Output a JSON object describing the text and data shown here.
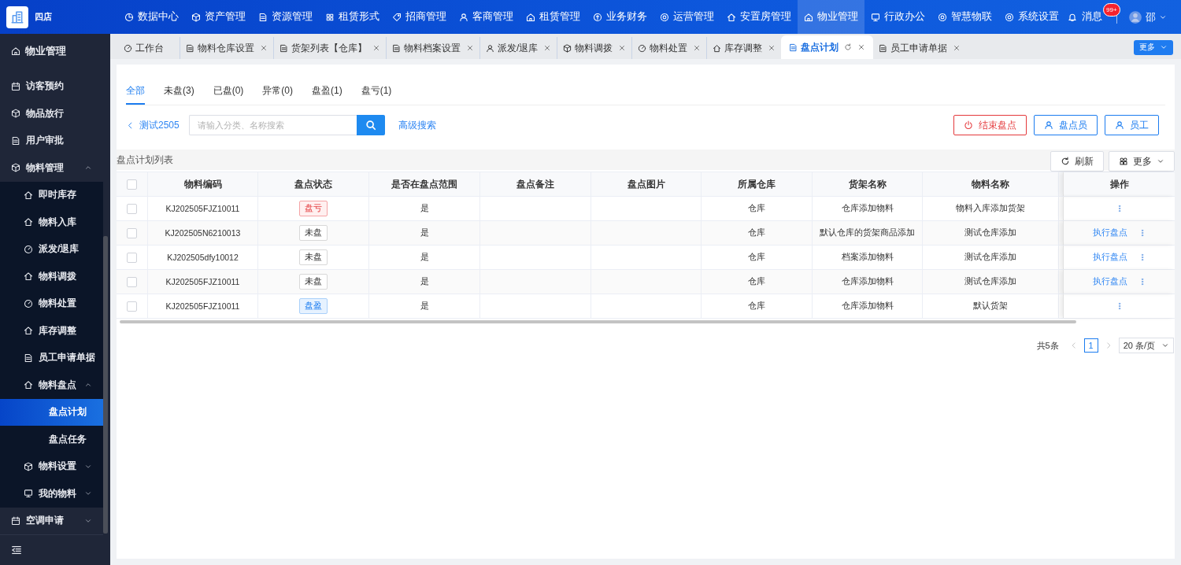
{
  "brand": {
    "name": "四店"
  },
  "top_nav": [
    {
      "label": "数据中心",
      "selected": false
    },
    {
      "label": "资产管理",
      "selected": false
    },
    {
      "label": "资源管理",
      "selected": false
    },
    {
      "label": "租赁形式",
      "selected": false
    },
    {
      "label": "招商管理",
      "selected": false
    },
    {
      "label": "客商管理",
      "selected": false
    },
    {
      "label": "租赁管理",
      "selected": false
    },
    {
      "label": "业务财务",
      "selected": false
    },
    {
      "label": "运营管理",
      "selected": false
    },
    {
      "label": "安置房管理",
      "selected": false
    },
    {
      "label": "物业管理",
      "selected": true
    },
    {
      "label": "行政办公",
      "selected": false
    },
    {
      "label": "智慧物联",
      "selected": false
    },
    {
      "label": "系统设置",
      "selected": false
    }
  ],
  "header_right": {
    "messages_label": "消息",
    "badge": "99+",
    "user": "邵"
  },
  "sidebar": {
    "title": "物业管理",
    "items": [
      {
        "label": "访客预约",
        "selected": false
      },
      {
        "label": "物品放行",
        "selected": false
      },
      {
        "label": "用户审批",
        "selected": false
      },
      {
        "label": "物料管理",
        "selected": false,
        "expanded": true,
        "children": [
          {
            "label": "即时库存",
            "selected": false
          },
          {
            "label": "物料入库",
            "selected": false
          },
          {
            "label": "派发/退库",
            "selected": false
          },
          {
            "label": "物料调拨",
            "selected": false
          },
          {
            "label": "物料处置",
            "selected": false
          },
          {
            "label": "库存调整",
            "selected": false
          },
          {
            "label": "员工申请单据",
            "selected": false
          },
          {
            "label": "物料盘点",
            "selected": false,
            "expanded": true,
            "children": [
              {
                "label": "盘点计划",
                "selected": true
              },
              {
                "label": "盘点任务",
                "selected": false
              }
            ]
          },
          {
            "label": "物料设置",
            "selected": false,
            "expanded": false
          },
          {
            "label": "我的物料",
            "selected": false,
            "expanded": false
          }
        ]
      },
      {
        "label": "空调申请",
        "selected": false,
        "expanded": false
      }
    ]
  },
  "page_tabs": [
    {
      "label": "工作台",
      "selected": false,
      "closable": false
    },
    {
      "label": "物料仓库设置",
      "selected": false,
      "closable": true
    },
    {
      "label": "货架列表【仓库】",
      "selected": false,
      "closable": true
    },
    {
      "label": "物料档案设置",
      "selected": false,
      "closable": true
    },
    {
      "label": "派发/退库",
      "selected": false,
      "closable": true
    },
    {
      "label": "物料调拨",
      "selected": false,
      "closable": true
    },
    {
      "label": "物料处置",
      "selected": false,
      "closable": true
    },
    {
      "label": "库存调整",
      "selected": false,
      "closable": true
    },
    {
      "label": "盘点计划",
      "selected": true,
      "closable": true
    },
    {
      "label": "员工申请单据",
      "selected": false,
      "closable": true
    }
  ],
  "more_tabs_button": "更多",
  "filter_tabs": [
    {
      "label": "全部",
      "selected": true
    },
    {
      "label": "未盘(3)",
      "selected": false
    },
    {
      "label": "已盘(0)",
      "selected": false
    },
    {
      "label": "异常(0)",
      "selected": false
    },
    {
      "label": "盘盈(1)",
      "selected": false
    },
    {
      "label": "盘亏(1)",
      "selected": false
    }
  ],
  "back_link": "测试2505",
  "search": {
    "placeholder": "请输入分类、名称搜索"
  },
  "advanced_search": "高级搜索",
  "actions": [
    {
      "label": "结束盘点",
      "kind": "danger"
    },
    {
      "label": "盘点员",
      "kind": "person"
    },
    {
      "label": "员工",
      "kind": "person"
    }
  ],
  "table": {
    "title": "盘点计划列表",
    "all_checked": false,
    "refresh": "刷新",
    "more": "更多",
    "columns": [
      "物料编码",
      "盘点状态",
      "是否在盘点范围",
      "盘点备注",
      "盘点图片",
      "所属仓库",
      "货架名称",
      "物料名称",
      "操作"
    ],
    "rows": [
      {
        "checked": false,
        "code": "KJ202505FJZ10011",
        "status": {
          "label": "盘亏",
          "kind": "loss"
        },
        "in_range": "是",
        "warehouse": "仓库",
        "shelf": "仓库添加物料",
        "material": "物料入库添加货架"
      },
      {
        "checked": false,
        "code": "KJ202505N6210013",
        "status": {
          "label": "未盘",
          "kind": "pending"
        },
        "in_range": "是",
        "warehouse": "仓库",
        "shelf": "默认仓库的货架商品添加",
        "material": "测试仓库添加",
        "action": "执行盘点"
      },
      {
        "checked": false,
        "code": "KJ202505dfy10012",
        "status": {
          "label": "未盘",
          "kind": "pending"
        },
        "in_range": "是",
        "warehouse": "仓库",
        "shelf": "档案添加物料",
        "material": "测试仓库添加",
        "action": "执行盘点"
      },
      {
        "checked": false,
        "code": "KJ202505FJZ10011",
        "status": {
          "label": "未盘",
          "kind": "pending"
        },
        "in_range": "是",
        "warehouse": "仓库",
        "shelf": "仓库添加物料",
        "material": "测试仓库添加",
        "action": "执行盘点"
      },
      {
        "checked": false,
        "code": "KJ202505FJZ10011",
        "status": {
          "label": "盘盈",
          "kind": "gain"
        },
        "in_range": "是",
        "warehouse": "仓库",
        "shelf": "仓库添加物料",
        "material": "默认货架"
      }
    ]
  },
  "pagination": {
    "total": "共5条",
    "pages": [
      {
        "label": "1",
        "selected": true
      }
    ],
    "page_size": "20 条/页"
  }
}
